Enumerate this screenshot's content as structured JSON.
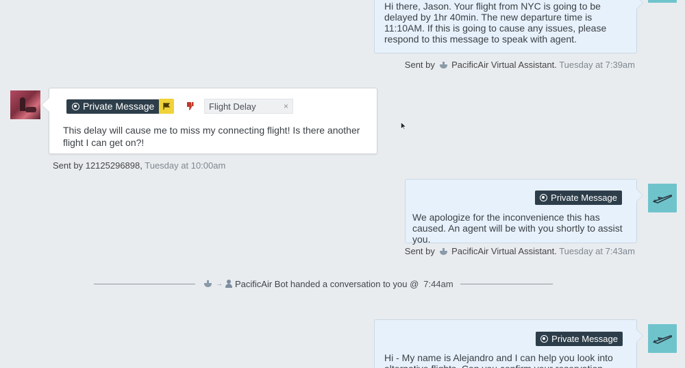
{
  "messages": {
    "m1": {
      "text": "Hi there, Jason. Your flight from NYC is going to be delayed by 1hr 40min. The new departure time is 11:10AM. If this is going to cause any issues, please respond to this message to speak with agent.",
      "sender_prefix": "Sent by",
      "sender": "PacificAir Virtual Assistant.",
      "time": "Tuesday at 7:39am"
    },
    "m2": {
      "badge": "Private Message",
      "tag": "Flight Delay",
      "tag_remove": "×",
      "text": "This delay will cause me to miss my connecting flight! Is there another flight I can get on?!",
      "sender_prefix": "Sent by",
      "sender": "12125296898,",
      "time": "Tuesday at 10:00am"
    },
    "m3": {
      "badge": "Private Message",
      "text": "We apologize for the inconvenience this has caused. An agent will be with you shortly to assist you.",
      "sender_prefix": "Sent by",
      "sender": "PacificAir Virtual Assistant.",
      "time": "Tuesday at 7:43am"
    },
    "m4": {
      "badge": "Private Message",
      "text": "Hi - My name is Alejandro and I can help you look into alternative flights. Can you confirm your reservation code?"
    }
  },
  "handoff": {
    "text": "PacificAir Bot handed a conversation to you @",
    "time": "7:44am"
  },
  "colors": {
    "background": "#e9ecef",
    "outgoing_bubble": "#e7f1fb",
    "badge": "#2d3e4a",
    "agent_avatar": "#6fc4cc",
    "flag": "#f0d23a",
    "thumb_down": "#c0392b"
  },
  "icons": {
    "badge": "whatsapp-icon",
    "flag": "flag-icon",
    "thumb": "thumbs-down-icon",
    "agent_avatar": "airplane-icon",
    "bot": "bot-icon",
    "person": "person-icon"
  }
}
